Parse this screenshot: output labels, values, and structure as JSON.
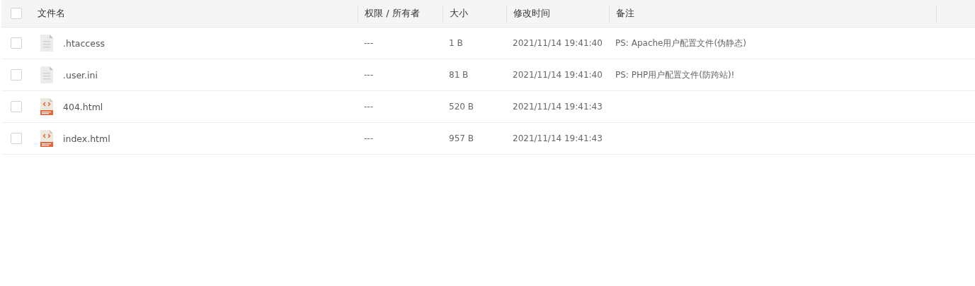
{
  "table": {
    "select_all": {
      "checked": false
    },
    "columns": [
      "文件名",
      "权限 / 所有者",
      "大小",
      "修改时间",
      "备注"
    ],
    "rows": [
      {
        "checked": false,
        "kind": "text",
        "name": ".htaccess",
        "permission": "---",
        "size": "1 B",
        "modified": "2021/11/14 19:41:40",
        "note": "PS: Apache用户配置文件(伪静态)"
      },
      {
        "checked": false,
        "kind": "text",
        "name": ".user.ini",
        "permission": "---",
        "size": "81 B",
        "modified": "2021/11/14 19:41:40",
        "note": "PS: PHP用户配置文件(防跨站)!"
      },
      {
        "checked": false,
        "kind": "html",
        "name": "404.html",
        "permission": "---",
        "size": "520 B",
        "modified": "2021/11/14 19:41:43"
      },
      {
        "checked": false,
        "kind": "html",
        "name": "index.html",
        "permission": "---",
        "size": "957 B",
        "modified": "2021/11/14 19:41:43"
      }
    ]
  }
}
